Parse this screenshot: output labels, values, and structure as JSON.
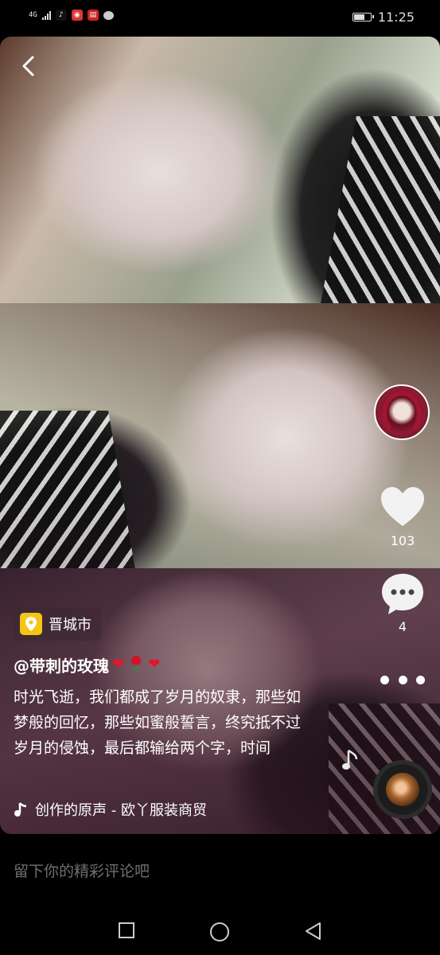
{
  "status_bar": {
    "network": "4G",
    "time": "11:25"
  },
  "video": {
    "location": "晋城市",
    "author": "@带刺的玫瑰",
    "caption": "时光飞逝，我们都成了岁月的奴隶，那些如梦般的回忆，那些如蜜般誓言，终究抵不过岁月的侵蚀，最后都输给两个字，时间",
    "music": "创作的原声 - 欧丫服装商贸"
  },
  "actions": {
    "like_count": "103",
    "comment_count": "4"
  },
  "comment_bar": {
    "placeholder": "留下你的精彩评论吧"
  },
  "icons": {
    "back": "chevron-left-icon",
    "like": "heart-icon",
    "comment": "speech-bubble-icon",
    "more": "more-dots-icon",
    "location": "location-pin-icon",
    "music": "music-note-icon"
  },
  "colors": {
    "background": "#000000",
    "location_icon": "#f3c614",
    "heart_emoji": "#e5152b"
  }
}
